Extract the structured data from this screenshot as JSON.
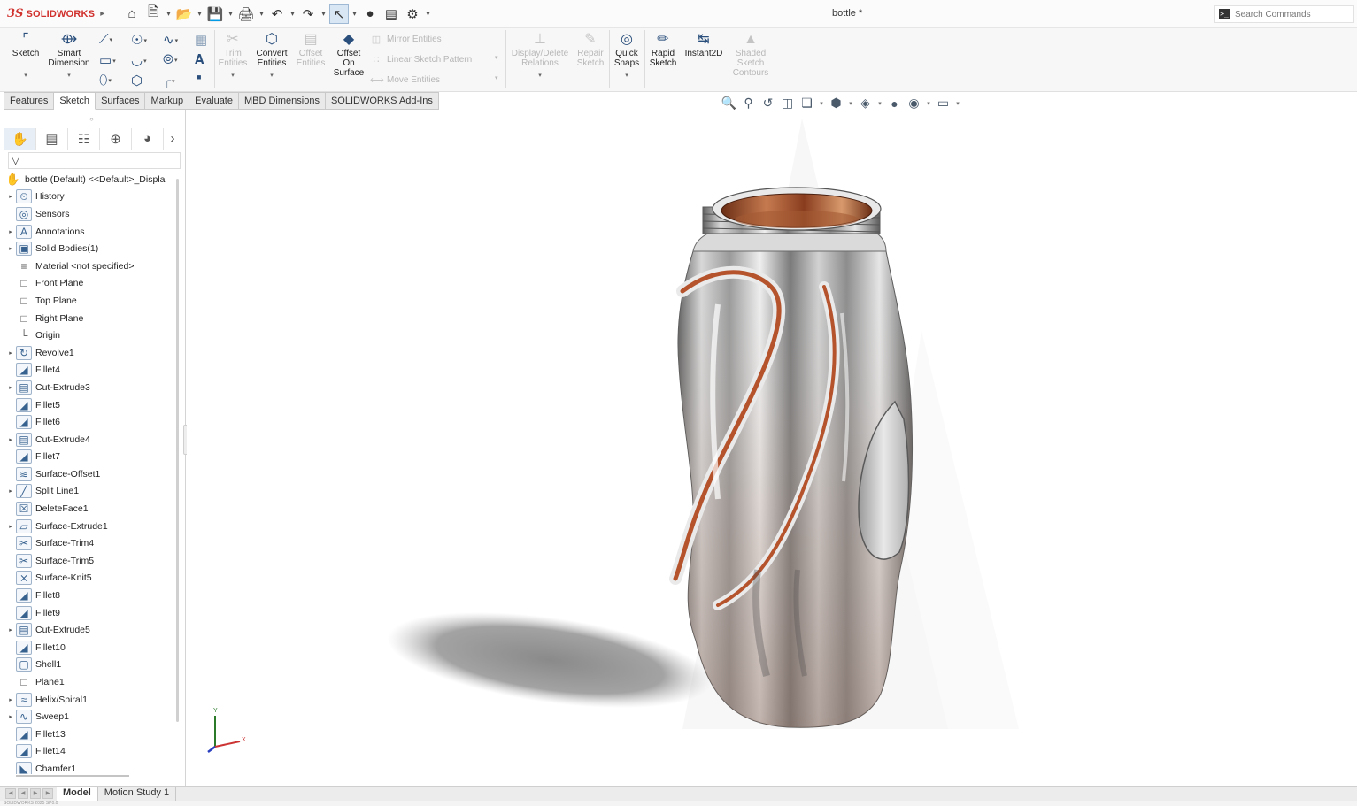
{
  "app": {
    "logo_prefix": "3S",
    "logo_text": "SOLIDWORKS",
    "document_title": "bottle *",
    "search_placeholder": "Search Commands"
  },
  "ribbon": {
    "sketch": "Sketch",
    "smart_dimension": [
      "Smart",
      "Dimension"
    ],
    "trim_entities": [
      "Trim",
      "Entities"
    ],
    "convert_entities": [
      "Convert",
      "Entities"
    ],
    "offset_entities": [
      "Offset",
      "Entities"
    ],
    "offset_on_surface": [
      "Offset",
      "On",
      "Surface"
    ],
    "mirror_entities": "Mirror Entities",
    "linear_sketch_pattern": "Linear Sketch Pattern",
    "move_entities": "Move Entities",
    "display_delete_relations": [
      "Display/Delete",
      "Relations"
    ],
    "repair_sketch": [
      "Repair",
      "Sketch"
    ],
    "quick_snaps": [
      "Quick",
      "Snaps"
    ],
    "rapid_sketch": [
      "Rapid",
      "Sketch"
    ],
    "instant2d": "Instant2D",
    "shaded_sketch_contours": [
      "Shaded",
      "Sketch",
      "Contours"
    ]
  },
  "tabs": [
    "Features",
    "Sketch",
    "Surfaces",
    "Markup",
    "Evaluate",
    "MBD Dimensions",
    "SOLIDWORKS Add-Ins"
  ],
  "active_tab": "Sketch",
  "tree": {
    "root": "bottle (Default) <<Default>_Displa",
    "items": [
      {
        "label": "History",
        "icon": "history-icon",
        "expand": true
      },
      {
        "label": "Sensors",
        "icon": "sensors-icon",
        "expand": false
      },
      {
        "label": "Annotations",
        "icon": "annotations-icon",
        "expand": true
      },
      {
        "label": "Solid Bodies(1)",
        "icon": "solid-bodies-icon",
        "expand": true
      },
      {
        "label": "Material <not specified>",
        "icon": "material-icon",
        "expand": false
      },
      {
        "label": "Front Plane",
        "icon": "plane-icon",
        "expand": false
      },
      {
        "label": "Top Plane",
        "icon": "plane-icon",
        "expand": false
      },
      {
        "label": "Right Plane",
        "icon": "plane-icon",
        "expand": false
      },
      {
        "label": "Origin",
        "icon": "origin-icon",
        "expand": false
      },
      {
        "label": "Revolve1",
        "icon": "revolve-icon",
        "expand": true
      },
      {
        "label": "Fillet4",
        "icon": "fillet-icon",
        "expand": false
      },
      {
        "label": "Cut-Extrude3",
        "icon": "cut-extrude-icon",
        "expand": true
      },
      {
        "label": "Fillet5",
        "icon": "fillet-icon",
        "expand": false
      },
      {
        "label": "Fillet6",
        "icon": "fillet-icon",
        "expand": false
      },
      {
        "label": "Cut-Extrude4",
        "icon": "cut-extrude-icon",
        "expand": true
      },
      {
        "label": "Fillet7",
        "icon": "fillet-icon",
        "expand": false
      },
      {
        "label": "Surface-Offset1",
        "icon": "surface-offset-icon",
        "expand": false
      },
      {
        "label": "Split Line1",
        "icon": "split-line-icon",
        "expand": true
      },
      {
        "label": "DeleteFace1",
        "icon": "delete-face-icon",
        "expand": false
      },
      {
        "label": "Surface-Extrude1",
        "icon": "surface-extrude-icon",
        "expand": true
      },
      {
        "label": "Surface-Trim4",
        "icon": "surface-trim-icon",
        "expand": false
      },
      {
        "label": "Surface-Trim5",
        "icon": "surface-trim-icon",
        "expand": false
      },
      {
        "label": "Surface-Knit5",
        "icon": "surface-knit-icon",
        "expand": false
      },
      {
        "label": "Fillet8",
        "icon": "fillet-icon",
        "expand": false
      },
      {
        "label": "Fillet9",
        "icon": "fillet-icon",
        "expand": false
      },
      {
        "label": "Cut-Extrude5",
        "icon": "cut-extrude-icon",
        "expand": true
      },
      {
        "label": "Fillet10",
        "icon": "fillet-icon",
        "expand": false
      },
      {
        "label": "Shell1",
        "icon": "shell-icon",
        "expand": false
      },
      {
        "label": "Plane1",
        "icon": "plane-icon",
        "expand": false
      },
      {
        "label": "Helix/Spiral1",
        "icon": "helix-icon",
        "expand": true
      },
      {
        "label": "Sweep1",
        "icon": "sweep-icon",
        "expand": true
      },
      {
        "label": "Fillet13",
        "icon": "fillet-icon",
        "expand": false
      },
      {
        "label": "Fillet14",
        "icon": "fillet-icon",
        "expand": false
      },
      {
        "label": "Chamfer1",
        "icon": "chamfer-icon",
        "expand": false
      }
    ]
  },
  "triad": {
    "y_label": "Y",
    "x_label": "X"
  },
  "bottom_tabs": [
    "Model",
    "Motion Study 1"
  ],
  "active_bottom_tab": "Model",
  "status_text": "SOLIDWORKS 2025 SP0.0",
  "colors": {
    "brand_red": "#d0312d",
    "copper": "#b5532d",
    "chrome_light": "#f2f2f2",
    "chrome_dark": "#6e6e6e"
  }
}
